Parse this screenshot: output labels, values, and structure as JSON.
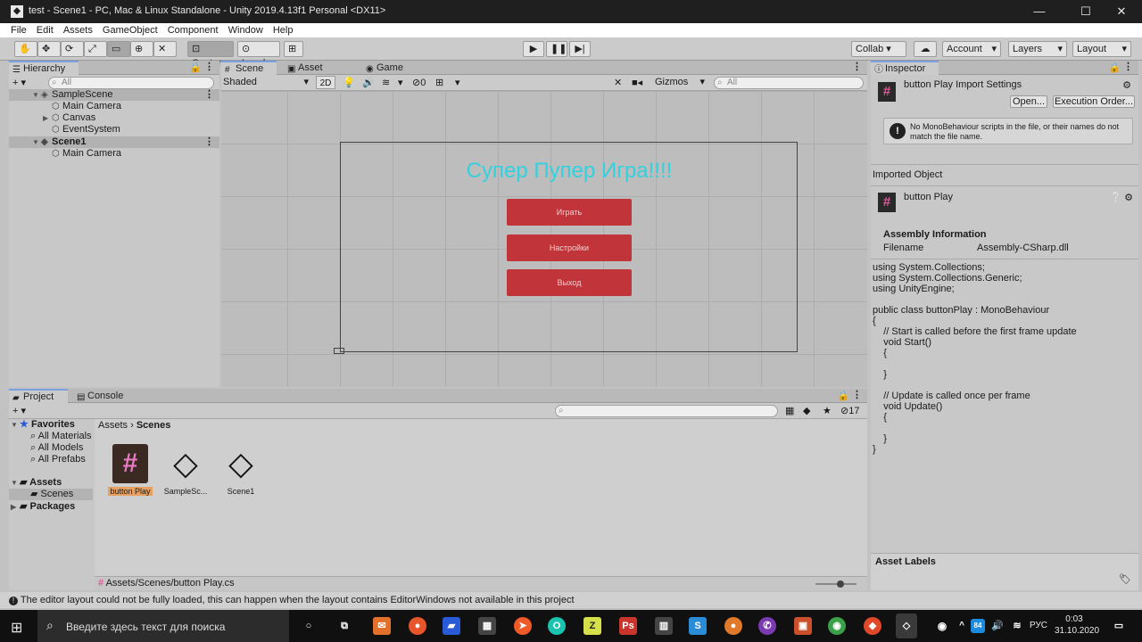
{
  "window": {
    "title": "test - Scene1 - PC, Mac & Linux Standalone - Unity 2019.4.13f1 Personal <DX11>",
    "minimize": "—",
    "maximize": "☐",
    "close": "✕"
  },
  "menu": [
    "File",
    "Edit",
    "Assets",
    "GameObject",
    "Component",
    "Window",
    "Help"
  ],
  "toolbar": {
    "pivot_center": "Center",
    "pivot_local": "Local",
    "collab": "Collab ▾",
    "account": "Account",
    "layers": "Layers",
    "layout": "Layout"
  },
  "hierarchy": {
    "tab": "Hierarchy",
    "add": "+ ▾",
    "search_placeholder": "All",
    "rows": [
      {
        "label": "SampleScene",
        "type": "scene"
      },
      {
        "label": "Main Camera",
        "type": "object"
      },
      {
        "label": "Canvas",
        "type": "object-collapsed"
      },
      {
        "label": "EventSystem",
        "type": "object"
      },
      {
        "label": "Scene1",
        "type": "scene"
      },
      {
        "label": "Main Camera",
        "type": "object"
      }
    ]
  },
  "scene": {
    "tabs": [
      "Scene",
      "Asset Store",
      "Game"
    ],
    "shading": "Shaded",
    "mode_2d": "2D",
    "fx_count": "0",
    "gizmos": "Gizmos",
    "search_placeholder": "All",
    "game_title": "Супер Пупер Игра!!!!",
    "buttons": [
      "Играть",
      "Настройки",
      "Выход"
    ]
  },
  "project": {
    "tabs": [
      "Project",
      "Console"
    ],
    "add": "+ ▾",
    "favorites": "Favorites",
    "favorite_items": [
      "All Materials",
      "All Models",
      "All Prefabs"
    ],
    "assets_root": "Assets",
    "scenes_folder": "Scenes",
    "packages": "Packages",
    "breadcrumb_root": "Assets",
    "breadcrumb_current": "Scenes",
    "hidden_count": "17",
    "files": [
      {
        "name": "button Play",
        "kind": "script"
      },
      {
        "name": "SampleSc...",
        "kind": "scene"
      },
      {
        "name": "Scene1",
        "kind": "scene"
      }
    ],
    "selected_path": "Assets/Scenes/button Play.cs"
  },
  "inspector": {
    "tab": "Inspector",
    "title": "button Play Import Settings",
    "open_button": "Open...",
    "exec_button": "Execution Order...",
    "warning": "No MonoBehaviour scripts in the file, or their names do not match the file name.",
    "imported_object": "Imported Object",
    "object_name": "button Play",
    "assembly_info": "Assembly Information",
    "filename_label": "Filename",
    "filename_value": "Assembly-CSharp.dll",
    "code": "using System.Collections;\nusing System.Collections.Generic;\nusing UnityEngine;\n\npublic class buttonPlay : MonoBehaviour\n{\n    // Start is called before the first frame update\n    void Start()\n    {\n\n    }\n\n    // Update is called once per frame\n    void Update()\n    {\n\n    }\n}",
    "asset_labels": "Asset Labels"
  },
  "status": {
    "message": "The editor layout could not be fully loaded, this can happen when the layout contains EditorWindows not available in this project"
  },
  "taskbar": {
    "search_placeholder": "Введите здесь текст для поиска",
    "lang": "РУС",
    "time": "0:03",
    "date": "31.10.2020"
  }
}
